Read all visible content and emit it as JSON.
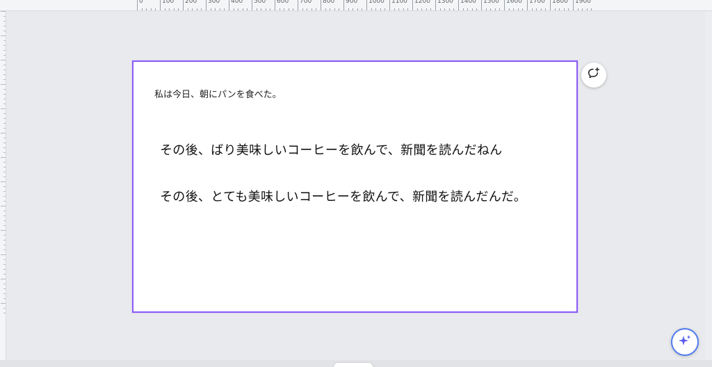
{
  "ruler": {
    "top_labels": [
      "0",
      "100",
      "200",
      "300",
      "400",
      "500",
      "600",
      "700",
      "800",
      "900",
      "1000",
      "1100",
      "1200",
      "1300",
      "1400",
      "1500",
      "1600",
      "1700",
      "1800",
      "1900"
    ]
  },
  "page": {
    "small_text": "私は今日、朝にパンを食べた。",
    "line_1": "その後、ばり美味しいコーヒーを飲んで、新聞を読んだねん",
    "line_2": "その後、とても美味しいコーヒーを飲んで、新聞を読んだんだ。"
  },
  "colors": {
    "selection_border": "#8b5cf6",
    "magic_accent": "#4f7cf0",
    "workspace_bg": "#e9eaed"
  },
  "icons": {
    "comment": "add-comment-icon",
    "magic": "sparkle-icon"
  }
}
